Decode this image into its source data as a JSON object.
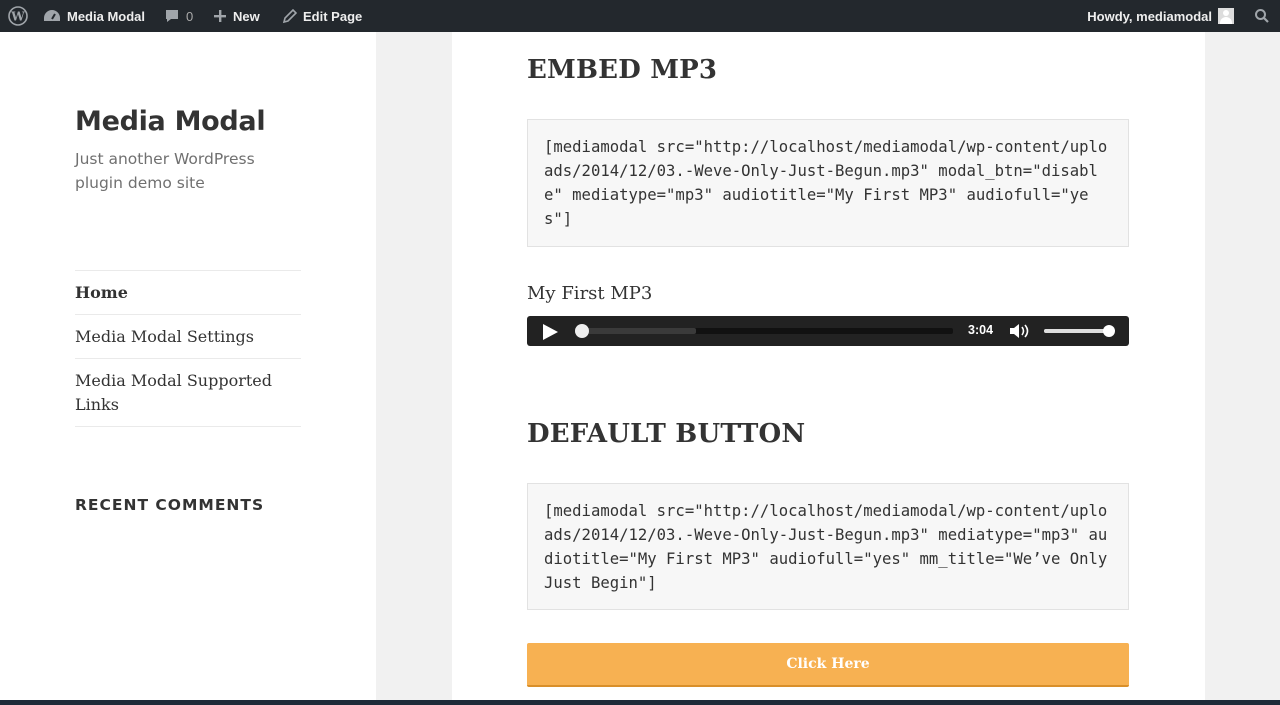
{
  "adminbar": {
    "wp_icon": "wordpress-logo-icon",
    "site_name": "Media Modal",
    "comment_count": "0",
    "new_label": "New",
    "edit_label": "Edit Page",
    "howdy": "Howdy, mediamodal",
    "search_icon": "search-icon"
  },
  "sidebar": {
    "site_title": "Media Modal",
    "site_description": "Just another WordPress plugin demo site",
    "nav": [
      {
        "label": "Home"
      },
      {
        "label": "Media Modal Settings"
      },
      {
        "label": "Media Modal Supported Links"
      }
    ],
    "widget_title": "RECENT COMMENTS"
  },
  "content": {
    "section1_heading": "EMBED MP3",
    "section1_code": "[mediamodal src=\"http://localhost/mediamodal/wp-content/uploads/2014/12/03.-Weve-Only-Just-Begun.mp3\" modal_btn=\"disable\" mediatype=\"mp3\" audiotitle=\"My First MP3\" audiofull=\"yes\"]",
    "audio_title": "My First MP3",
    "player": {
      "time": "3:04",
      "loaded_fraction": 0.32,
      "played_fraction": 0.0,
      "volume_fraction": 1.0
    },
    "section2_heading": "DEFAULT BUTTON",
    "section2_code": "[mediamodal src=\"http://localhost/mediamodal/wp-content/uploads/2014/12/03.-Weve-Only-Just-Begun.mp3\" mediatype=\"mp3\" audiotitle=\"My First MP3\" audiofull=\"yes\" mm_title=\"We’ve Only Just Begin\"]",
    "button_label": "Click Here"
  },
  "colors": {
    "adminbar": "#23282d",
    "button": "#f7b152",
    "player": "#222222"
  }
}
